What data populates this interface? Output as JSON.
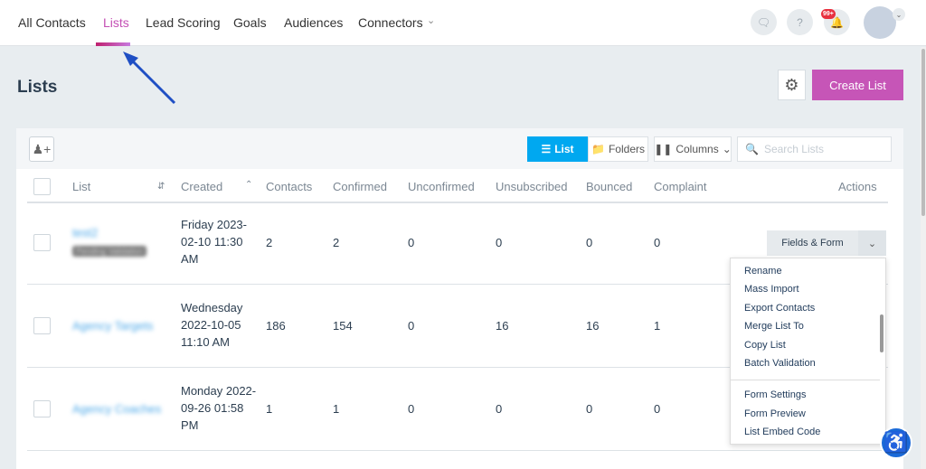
{
  "nav": {
    "items": [
      "All Contacts",
      "Lists",
      "Lead Scoring",
      "Goals",
      "Audiences",
      "Connectors"
    ],
    "active": "Lists",
    "notification_badge": "99+"
  },
  "page": {
    "title": "Lists",
    "create_button": "Create List"
  },
  "toolbar": {
    "list_view": "List",
    "folders_view": "Folders",
    "columns": "Columns",
    "search_placeholder": "Search Lists"
  },
  "table": {
    "headers": [
      "List",
      "Created",
      "Contacts",
      "Confirmed",
      "Unconfirmed",
      "Unsubscribed",
      "Bounced",
      "Complaint",
      "Actions"
    ],
    "rows": [
      {
        "name": "test2",
        "tag": "Pending Validation",
        "created": [
          "Friday 2023-",
          "02-10 11:30",
          "AM"
        ],
        "contacts": "2",
        "confirmed": "2",
        "unconfirmed": "0",
        "unsubscribed": "0",
        "bounced": "0",
        "complaint": "0"
      },
      {
        "name": "Agency Targets",
        "created": [
          "Wednesday",
          "2022-10-05",
          "11:10 AM"
        ],
        "contacts": "186",
        "confirmed": "154",
        "unconfirmed": "0",
        "unsubscribed": "16",
        "bounced": "16",
        "complaint": "1"
      },
      {
        "name": "Agency Coaches",
        "created": [
          "Monday 2022-",
          "09-26 01:58",
          "PM"
        ],
        "contacts": "1",
        "confirmed": "1",
        "unconfirmed": "0",
        "unsubscribed": "0",
        "bounced": "0",
        "complaint": "0"
      }
    ],
    "action_button": "Fields & Form"
  },
  "menu": {
    "items": [
      "Rename",
      "Mass Import",
      "Export Contacts",
      "Merge List To",
      "Copy List",
      "Batch Validation"
    ],
    "items2": [
      "Form Settings",
      "Form Preview",
      "List Embed Code"
    ]
  },
  "colors": {
    "accent": "#c655b7",
    "primary": "#00a8f0",
    "arrow": "#1f4fc4"
  }
}
